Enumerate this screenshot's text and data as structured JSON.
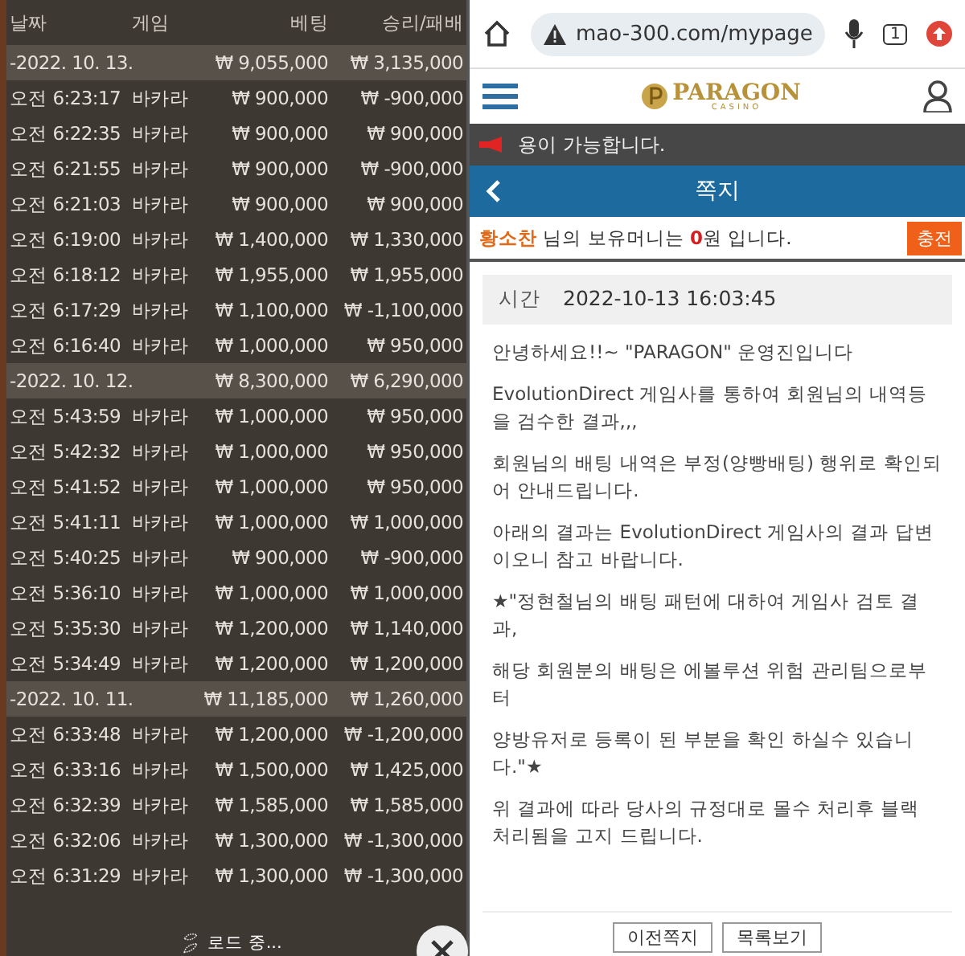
{
  "history": {
    "columns": [
      "날짜",
      "게임",
      "베팅",
      "승리/패배"
    ],
    "groups": [
      {
        "date": "-2022. 10. 13.",
        "bet": "₩ 9,055,000",
        "result": "₩ 3,135,000",
        "rows": [
          {
            "time": "오전 6:23:17",
            "game": "바카라",
            "bet": "₩ 900,000",
            "result": "₩ -900,000"
          },
          {
            "time": "오전 6:22:35",
            "game": "바카라",
            "bet": "₩ 900,000",
            "result": "₩ 900,000"
          },
          {
            "time": "오전 6:21:55",
            "game": "바카라",
            "bet": "₩ 900,000",
            "result": "₩ -900,000"
          },
          {
            "time": "오전 6:21:03",
            "game": "바카라",
            "bet": "₩ 900,000",
            "result": "₩ 900,000"
          },
          {
            "time": "오전 6:19:00",
            "game": "바카라",
            "bet": "₩ 1,400,000",
            "result": "₩ 1,330,000"
          },
          {
            "time": "오전 6:18:12",
            "game": "바카라",
            "bet": "₩ 1,955,000",
            "result": "₩ 1,955,000"
          },
          {
            "time": "오전 6:17:29",
            "game": "바카라",
            "bet": "₩ 1,100,000",
            "result": "₩ -1,100,000"
          },
          {
            "time": "오전 6:16:40",
            "game": "바카라",
            "bet": "₩ 1,000,000",
            "result": "₩ 950,000"
          }
        ]
      },
      {
        "date": "-2022. 10. 12.",
        "bet": "₩ 8,300,000",
        "result": "₩ 6,290,000",
        "rows": [
          {
            "time": "오전 5:43:59",
            "game": "바카라",
            "bet": "₩ 1,000,000",
            "result": "₩ 950,000"
          },
          {
            "time": "오전 5:42:32",
            "game": "바카라",
            "bet": "₩ 1,000,000",
            "result": "₩ 950,000"
          },
          {
            "time": "오전 5:41:52",
            "game": "바카라",
            "bet": "₩ 1,000,000",
            "result": "₩ 950,000"
          },
          {
            "time": "오전 5:41:11",
            "game": "바카라",
            "bet": "₩ 1,000,000",
            "result": "₩ 1,000,000"
          },
          {
            "time": "오전 5:40:25",
            "game": "바카라",
            "bet": "₩ 900,000",
            "result": "₩ -900,000"
          },
          {
            "time": "오전 5:36:10",
            "game": "바카라",
            "bet": "₩ 1,000,000",
            "result": "₩ 1,000,000"
          },
          {
            "time": "오전 5:35:30",
            "game": "바카라",
            "bet": "₩ 1,200,000",
            "result": "₩ 1,140,000"
          },
          {
            "time": "오전 5:34:49",
            "game": "바카라",
            "bet": "₩ 1,200,000",
            "result": "₩ 1,200,000"
          }
        ]
      },
      {
        "date": "-2022. 10. 11.",
        "bet": "₩ 11,185,000",
        "result": "₩ 1,260,000",
        "rows": [
          {
            "time": "오전 6:33:48",
            "game": "바카라",
            "bet": "₩ 1,200,000",
            "result": "₩ -1,200,000"
          },
          {
            "time": "오전 6:33:16",
            "game": "바카라",
            "bet": "₩ 1,500,000",
            "result": "₩ 1,425,000"
          },
          {
            "time": "오전 6:32:39",
            "game": "바카라",
            "bet": "₩ 1,585,000",
            "result": "₩ 1,585,000"
          },
          {
            "time": "오전 6:32:06",
            "game": "바카라",
            "bet": "₩ 1,300,000",
            "result": "₩ -1,300,000"
          },
          {
            "time": "오전 6:31:29",
            "game": "바카라",
            "bet": "₩ 1,300,000",
            "result": "₩ -1,300,000"
          }
        ]
      }
    ],
    "loading": {
      "label": "로드 중..."
    }
  },
  "browser": {
    "url": "mao-300.com/mypage",
    "tab_count": "1"
  },
  "site": {
    "logo": "PARAGON",
    "logo_sub": "CASINO",
    "notice": "용이 가능합니다.",
    "page_title": "쪽지",
    "balance_text": "**황소찬** 님의 보유머니는 **0**원 입니다.",
    "charge_button": "충전"
  },
  "message": {
    "time_label": "시간",
    "time": "2022-10-13 16:03:45",
    "paragraphs": [
      "안녕하세요!!~ \"PARAGON\" 운영진입니다",
      "EvolutionDirect 게임사를 통하여 회원님의 내역등을 검수한 결과,,,",
      "회원님의 배팅 내역은 부정(양빵배팅) 행위로 확인되어 안내드립니다.",
      "아래의 결과는 EvolutionDirect 게임사의 결과 답변이오니 참고 바랍니다.",
      "★\"정현철님의 배팅 패턴에 대하여 게임사 검토 결과,",
      "해당 회원분의 배팅은 에볼루션 위험 관리팀으로부터",
      "양방유저로 등록이 된 부분을 확인 하실수 있습니다.\"★",
      "위 결과에 따라 당사의 규정대로 몰수 처리후 블랙 처리됨을 고지 드립니다."
    ],
    "buttons": [
      "이전쪽지",
      "목록보기"
    ]
  }
}
